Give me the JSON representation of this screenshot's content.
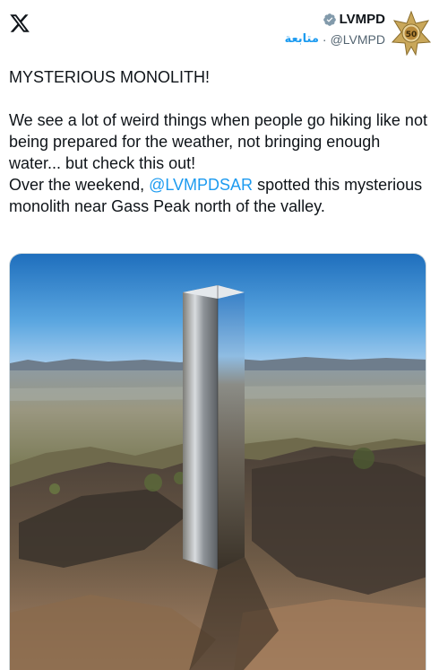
{
  "author": {
    "name": "LVMPD",
    "handle": "@LVMPD",
    "follow_label": "متابعة",
    "separator": "·",
    "badge_number": "50"
  },
  "tweet": {
    "line_1": "MYSTERIOUS MONOLITH!",
    "line_2": "We see a lot of weird things when people go hiking like not being prepared for the weather, not bringing enough water... but check this out!",
    "line_3_prefix": "Over the weekend, ",
    "mention": "@LVMPDSAR",
    "line_3_suffix": " spotted this mysterious monolith near Gass Peak north of the valley."
  },
  "colors": {
    "link": "#1d9bf0",
    "text": "#0f1419",
    "secondary": "#536471"
  },
  "icons": [
    "x-logo-icon",
    "verified-badge-icon",
    "police-star-badge-icon"
  ]
}
